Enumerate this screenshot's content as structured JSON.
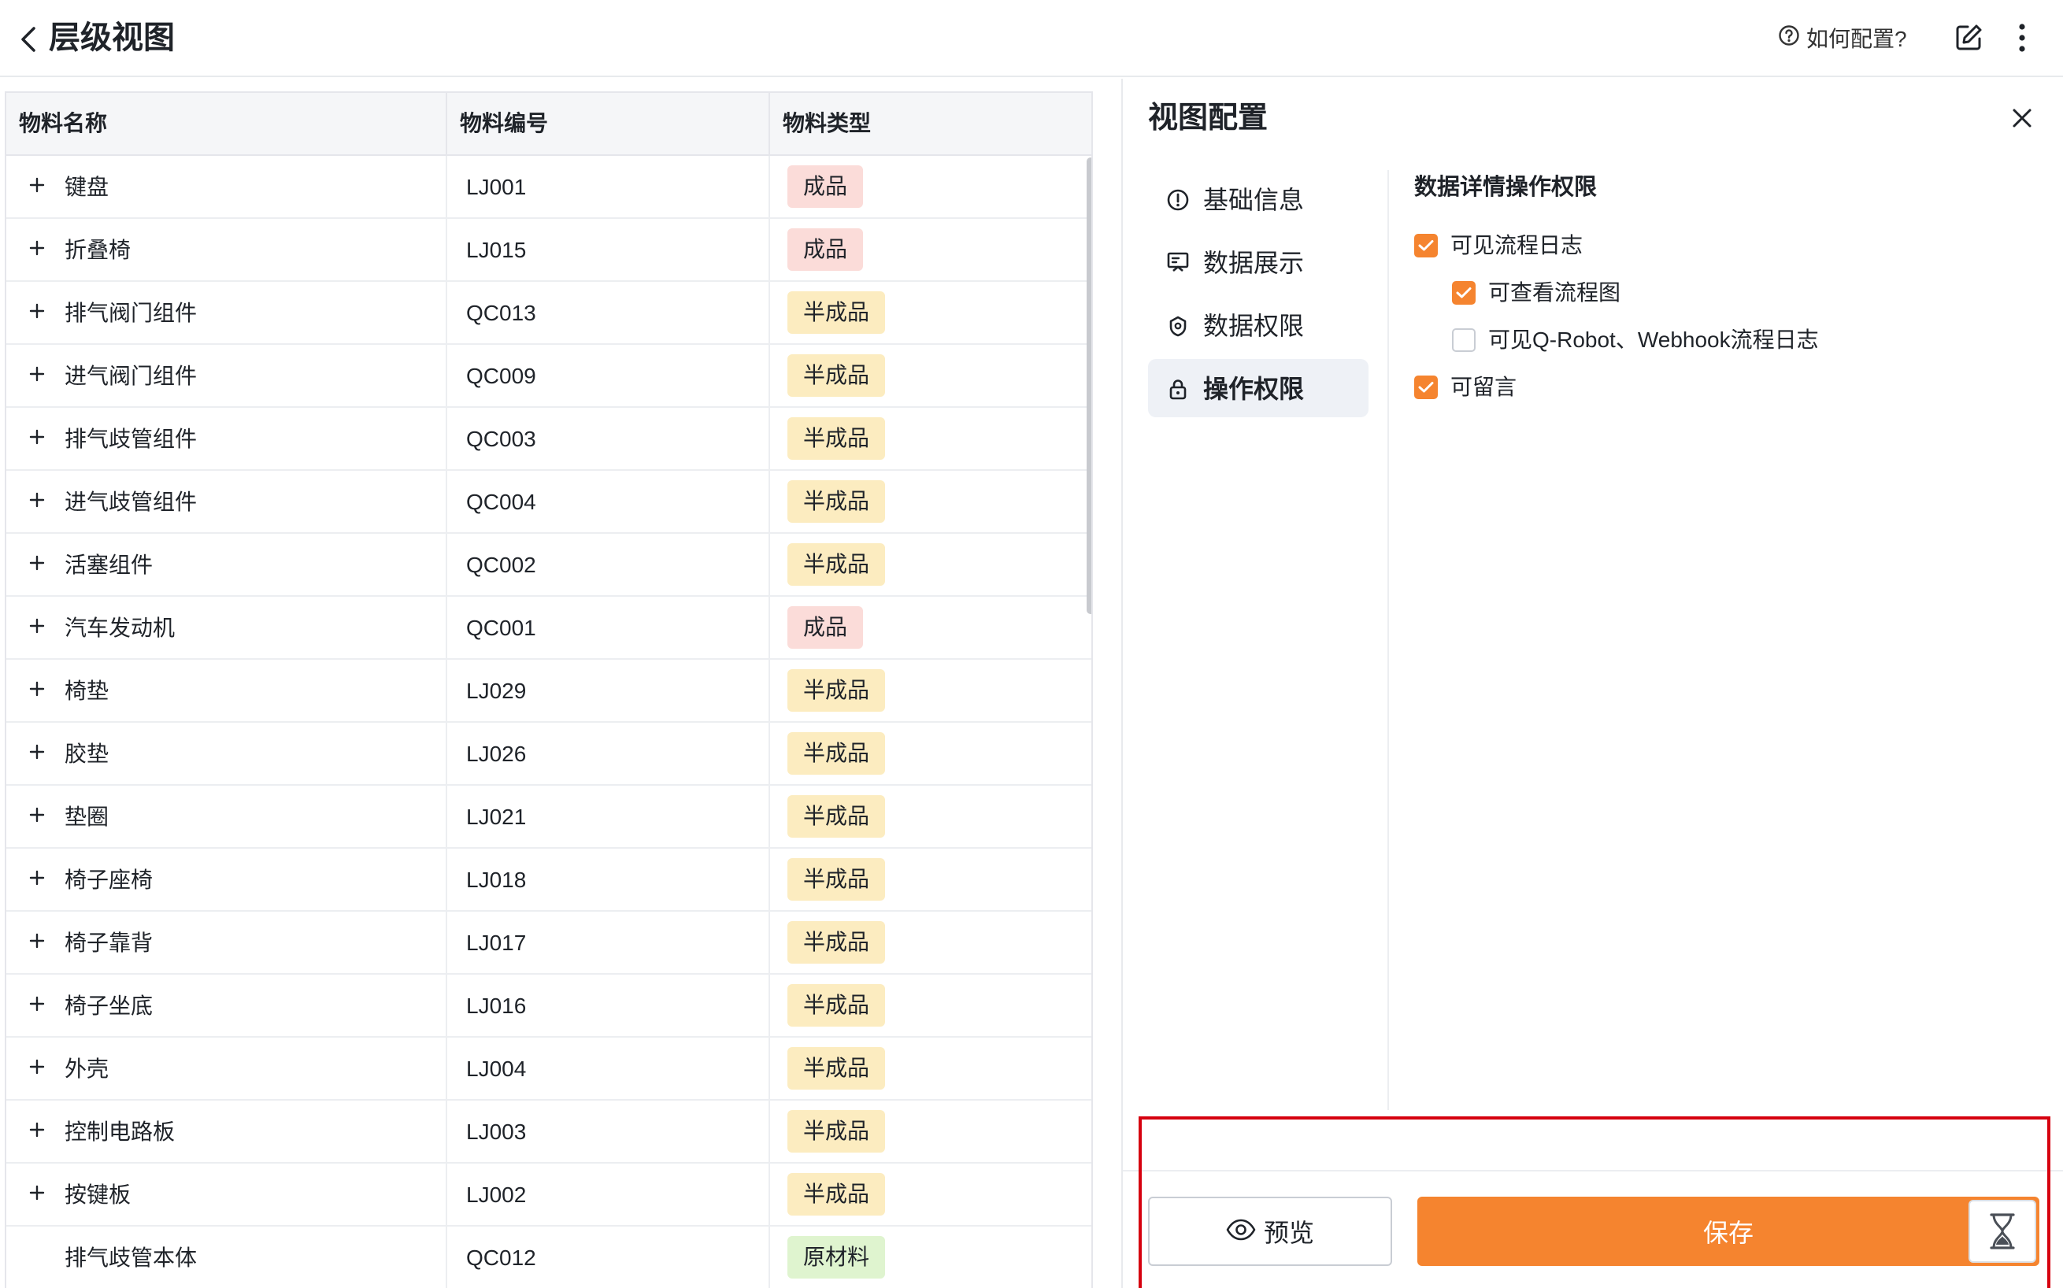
{
  "header": {
    "title": "层级视图",
    "help_label": "如何配置?"
  },
  "table": {
    "columns": [
      "物料名称",
      "物料编号",
      "物料类型"
    ],
    "rows": [
      {
        "name": "键盘",
        "code": "LJ001",
        "type": "成品",
        "expandable": true
      },
      {
        "name": "折叠椅",
        "code": "LJ015",
        "type": "成品",
        "expandable": true
      },
      {
        "name": "排气阀门组件",
        "code": "QC013",
        "type": "半成品",
        "expandable": true
      },
      {
        "name": "进气阀门组件",
        "code": "QC009",
        "type": "半成品",
        "expandable": true
      },
      {
        "name": "排气歧管组件",
        "code": "QC003",
        "type": "半成品",
        "expandable": true
      },
      {
        "name": "进气歧管组件",
        "code": "QC004",
        "type": "半成品",
        "expandable": true
      },
      {
        "name": "活塞组件",
        "code": "QC002",
        "type": "半成品",
        "expandable": true
      },
      {
        "name": "汽车发动机",
        "code": "QC001",
        "type": "成品",
        "expandable": true
      },
      {
        "name": "椅垫",
        "code": "LJ029",
        "type": "半成品",
        "expandable": true
      },
      {
        "name": "胶垫",
        "code": "LJ026",
        "type": "半成品",
        "expandable": true
      },
      {
        "name": "垫圈",
        "code": "LJ021",
        "type": "半成品",
        "expandable": true
      },
      {
        "name": "椅子座椅",
        "code": "LJ018",
        "type": "半成品",
        "expandable": true
      },
      {
        "name": "椅子靠背",
        "code": "LJ017",
        "type": "半成品",
        "expandable": true
      },
      {
        "name": "椅子坐底",
        "code": "LJ016",
        "type": "半成品",
        "expandable": true
      },
      {
        "name": "外壳",
        "code": "LJ004",
        "type": "半成品",
        "expandable": true
      },
      {
        "name": "控制电路板",
        "code": "LJ003",
        "type": "半成品",
        "expandable": true
      },
      {
        "name": "按键板",
        "code": "LJ002",
        "type": "半成品",
        "expandable": true
      },
      {
        "name": "排气歧管本体",
        "code": "QC012",
        "type": "原材料",
        "expandable": false
      }
    ]
  },
  "panel": {
    "title": "视图配置",
    "nav": [
      {
        "label": "基础信息",
        "icon": "info-icon"
      },
      {
        "label": "数据展示",
        "icon": "display-icon"
      },
      {
        "label": "数据权限",
        "icon": "data-permission-icon"
      },
      {
        "label": "操作权限",
        "icon": "lock-icon",
        "active": true
      }
    ],
    "section_title": "数据详情操作权限",
    "permissions": [
      {
        "label": "可见流程日志",
        "checked": true
      },
      {
        "label": "可查看流程图",
        "checked": true
      },
      {
        "label": "可见Q-Robot、Webhook流程日志",
        "checked": false
      },
      {
        "label": "可留言",
        "checked": true
      }
    ],
    "preview_label": "预览",
    "save_label": "保存"
  },
  "colors": {
    "accent": "#f5842f",
    "tag_finished": "#fbdcd9",
    "tag_semi": "#fcecc0",
    "tag_raw": "#dff4cf",
    "highlight": "#d6000f"
  }
}
